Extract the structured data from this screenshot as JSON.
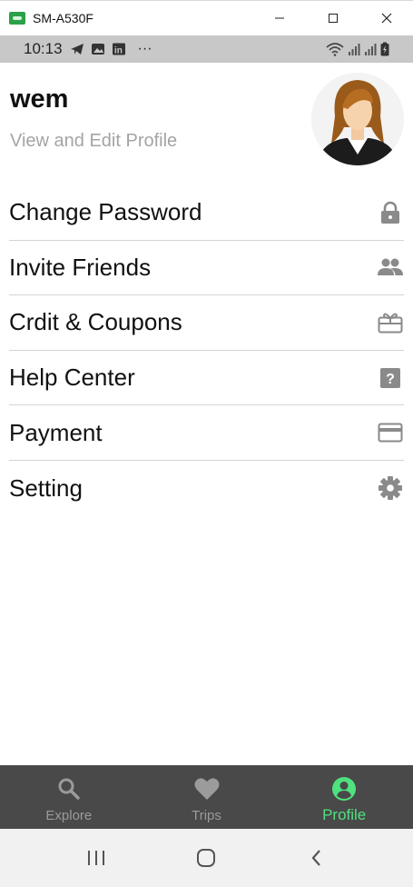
{
  "window": {
    "title": "SM-A530F"
  },
  "statusbar": {
    "time": "10:13",
    "overflow": "···"
  },
  "profile": {
    "name": "wem",
    "subtitle": "View and Edit Profile"
  },
  "menu": {
    "items": [
      {
        "label": "Change Password",
        "icon": "lock-icon"
      },
      {
        "label": "Invite Friends",
        "icon": "people-icon"
      },
      {
        "label": "Crdit & Coupons",
        "icon": "gift-card-icon"
      },
      {
        "label": "Help Center",
        "icon": "help-icon"
      },
      {
        "label": "Payment",
        "icon": "credit-card-icon"
      },
      {
        "label": "Setting",
        "icon": "gear-icon"
      }
    ]
  },
  "tabs": [
    {
      "label": "Explore",
      "icon": "search-icon",
      "active": false
    },
    {
      "label": "Trips",
      "icon": "heart-icon",
      "active": false
    },
    {
      "label": "Profile",
      "icon": "account-circle-icon",
      "active": true
    }
  ],
  "colors": {
    "accent": "#4fe07f",
    "tabbar_bg": "#494949",
    "inactive_tab": "#9b9b9b",
    "menu_icon": "#8a8a8a",
    "subtitle": "#a4a4a4"
  }
}
